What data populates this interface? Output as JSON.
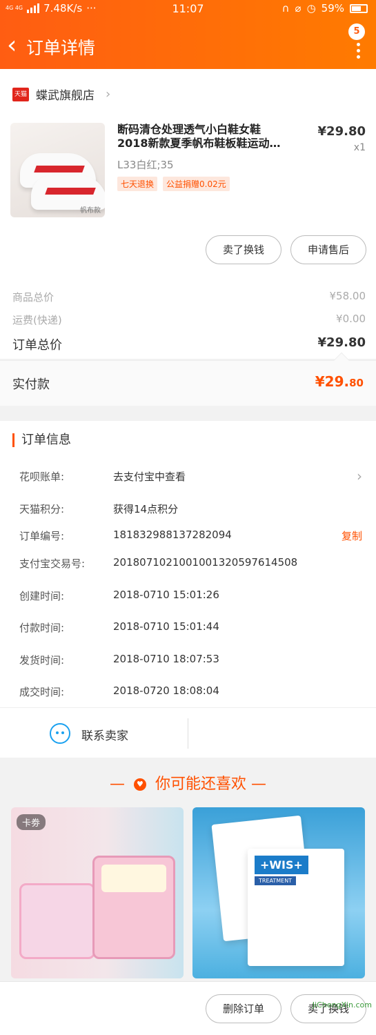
{
  "status_bar": {
    "network": "4G 4G",
    "speed": "7.48K/s",
    "time": "11:07",
    "battery": "59%"
  },
  "header": {
    "title": "订单详情",
    "badge_count": "5"
  },
  "shop": {
    "logo_text": "天猫",
    "name": "蝶武旗舰店"
  },
  "product": {
    "title_line1": "断码清仓处理透气小白鞋女鞋",
    "title_line2": "2018新款夏季帆布鞋板鞋运动…",
    "price": "¥29.80",
    "quantity": "x1",
    "sku": "L33白红;35",
    "thumb_label": "帆布款",
    "tags": [
      "七天退换",
      "公益捐赠0.02元"
    ]
  },
  "actions": {
    "return_label": "卖了换钱",
    "after_sale_label": "申请售后"
  },
  "totals": {
    "goods_label": "商品总价",
    "goods_value": "¥58.00",
    "shipping_label": "运费(快递)",
    "shipping_value": "¥0.00",
    "order_label": "订单总价",
    "order_value": "¥29.80"
  },
  "paid": {
    "label": "实付款",
    "value_main": "¥29.",
    "value_small": "80"
  },
  "order_info": {
    "title": "订单信息",
    "rows": [
      {
        "label": "花呗账单:",
        "value": "去支付宝中查看"
      },
      {
        "label": "天猫积分:",
        "value": "获得14点积分"
      },
      {
        "label": "订单编号:",
        "value": "181832988137282094"
      },
      {
        "label": "支付宝交易号:",
        "value": "2018071021001001320597614508"
      },
      {
        "label": "创建时间:",
        "value": "2018-0710 15:01:26"
      },
      {
        "label": "付款时间:",
        "value": "2018-0710 15:01:44"
      },
      {
        "label": "发货时间:",
        "value": "2018-0710 18:07:53"
      },
      {
        "label": "成交时间:",
        "value": "2018-0720 18:08:04"
      }
    ],
    "copy_label": "复制",
    "contact_label": "联系卖家"
  },
  "recommend": {
    "title": "你可能还喜欢",
    "item1_tag": "卡劵",
    "item2_brand": "+WIS+",
    "item2_sub": "TREATMENT"
  },
  "bottom": {
    "delete_label": "删除订单",
    "sell_label": "卖了换钱"
  },
  "watermark": "JiChengXin.com",
  "colors": {
    "accent": "#ff5000",
    "header": "#ff6a00",
    "contact_icon": "#1aa1f0"
  }
}
